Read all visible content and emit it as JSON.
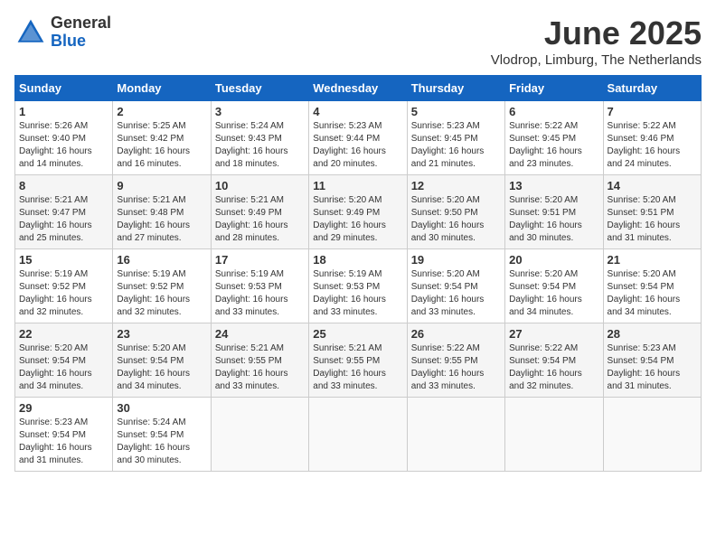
{
  "logo": {
    "general": "General",
    "blue": "Blue"
  },
  "title": "June 2025",
  "location": "Vlodrop, Limburg, The Netherlands",
  "weekdays": [
    "Sunday",
    "Monday",
    "Tuesday",
    "Wednesday",
    "Thursday",
    "Friday",
    "Saturday"
  ],
  "weeks": [
    [
      {
        "day": "1",
        "sunrise": "5:26 AM",
        "sunset": "9:40 PM",
        "daylight": "16 hours and 14 minutes."
      },
      {
        "day": "2",
        "sunrise": "5:25 AM",
        "sunset": "9:42 PM",
        "daylight": "16 hours and 16 minutes."
      },
      {
        "day": "3",
        "sunrise": "5:24 AM",
        "sunset": "9:43 PM",
        "daylight": "16 hours and 18 minutes."
      },
      {
        "day": "4",
        "sunrise": "5:23 AM",
        "sunset": "9:44 PM",
        "daylight": "16 hours and 20 minutes."
      },
      {
        "day": "5",
        "sunrise": "5:23 AM",
        "sunset": "9:45 PM",
        "daylight": "16 hours and 21 minutes."
      },
      {
        "day": "6",
        "sunrise": "5:22 AM",
        "sunset": "9:45 PM",
        "daylight": "16 hours and 23 minutes."
      },
      {
        "day": "7",
        "sunrise": "5:22 AM",
        "sunset": "9:46 PM",
        "daylight": "16 hours and 24 minutes."
      }
    ],
    [
      {
        "day": "8",
        "sunrise": "5:21 AM",
        "sunset": "9:47 PM",
        "daylight": "16 hours and 25 minutes."
      },
      {
        "day": "9",
        "sunrise": "5:21 AM",
        "sunset": "9:48 PM",
        "daylight": "16 hours and 27 minutes."
      },
      {
        "day": "10",
        "sunrise": "5:21 AM",
        "sunset": "9:49 PM",
        "daylight": "16 hours and 28 minutes."
      },
      {
        "day": "11",
        "sunrise": "5:20 AM",
        "sunset": "9:49 PM",
        "daylight": "16 hours and 29 minutes."
      },
      {
        "day": "12",
        "sunrise": "5:20 AM",
        "sunset": "9:50 PM",
        "daylight": "16 hours and 30 minutes."
      },
      {
        "day": "13",
        "sunrise": "5:20 AM",
        "sunset": "9:51 PM",
        "daylight": "16 hours and 30 minutes."
      },
      {
        "day": "14",
        "sunrise": "5:20 AM",
        "sunset": "9:51 PM",
        "daylight": "16 hours and 31 minutes."
      }
    ],
    [
      {
        "day": "15",
        "sunrise": "5:19 AM",
        "sunset": "9:52 PM",
        "daylight": "16 hours and 32 minutes."
      },
      {
        "day": "16",
        "sunrise": "5:19 AM",
        "sunset": "9:52 PM",
        "daylight": "16 hours and 32 minutes."
      },
      {
        "day": "17",
        "sunrise": "5:19 AM",
        "sunset": "9:53 PM",
        "daylight": "16 hours and 33 minutes."
      },
      {
        "day": "18",
        "sunrise": "5:19 AM",
        "sunset": "9:53 PM",
        "daylight": "16 hours and 33 minutes."
      },
      {
        "day": "19",
        "sunrise": "5:20 AM",
        "sunset": "9:54 PM",
        "daylight": "16 hours and 33 minutes."
      },
      {
        "day": "20",
        "sunrise": "5:20 AM",
        "sunset": "9:54 PM",
        "daylight": "16 hours and 34 minutes."
      },
      {
        "day": "21",
        "sunrise": "5:20 AM",
        "sunset": "9:54 PM",
        "daylight": "16 hours and 34 minutes."
      }
    ],
    [
      {
        "day": "22",
        "sunrise": "5:20 AM",
        "sunset": "9:54 PM",
        "daylight": "16 hours and 34 minutes."
      },
      {
        "day": "23",
        "sunrise": "5:20 AM",
        "sunset": "9:54 PM",
        "daylight": "16 hours and 34 minutes."
      },
      {
        "day": "24",
        "sunrise": "5:21 AM",
        "sunset": "9:55 PM",
        "daylight": "16 hours and 33 minutes."
      },
      {
        "day": "25",
        "sunrise": "5:21 AM",
        "sunset": "9:55 PM",
        "daylight": "16 hours and 33 minutes."
      },
      {
        "day": "26",
        "sunrise": "5:22 AM",
        "sunset": "9:55 PM",
        "daylight": "16 hours and 33 minutes."
      },
      {
        "day": "27",
        "sunrise": "5:22 AM",
        "sunset": "9:54 PM",
        "daylight": "16 hours and 32 minutes."
      },
      {
        "day": "28",
        "sunrise": "5:23 AM",
        "sunset": "9:54 PM",
        "daylight": "16 hours and 31 minutes."
      }
    ],
    [
      {
        "day": "29",
        "sunrise": "5:23 AM",
        "sunset": "9:54 PM",
        "daylight": "16 hours and 31 minutes."
      },
      {
        "day": "30",
        "sunrise": "5:24 AM",
        "sunset": "9:54 PM",
        "daylight": "16 hours and 30 minutes."
      },
      null,
      null,
      null,
      null,
      null
    ]
  ]
}
